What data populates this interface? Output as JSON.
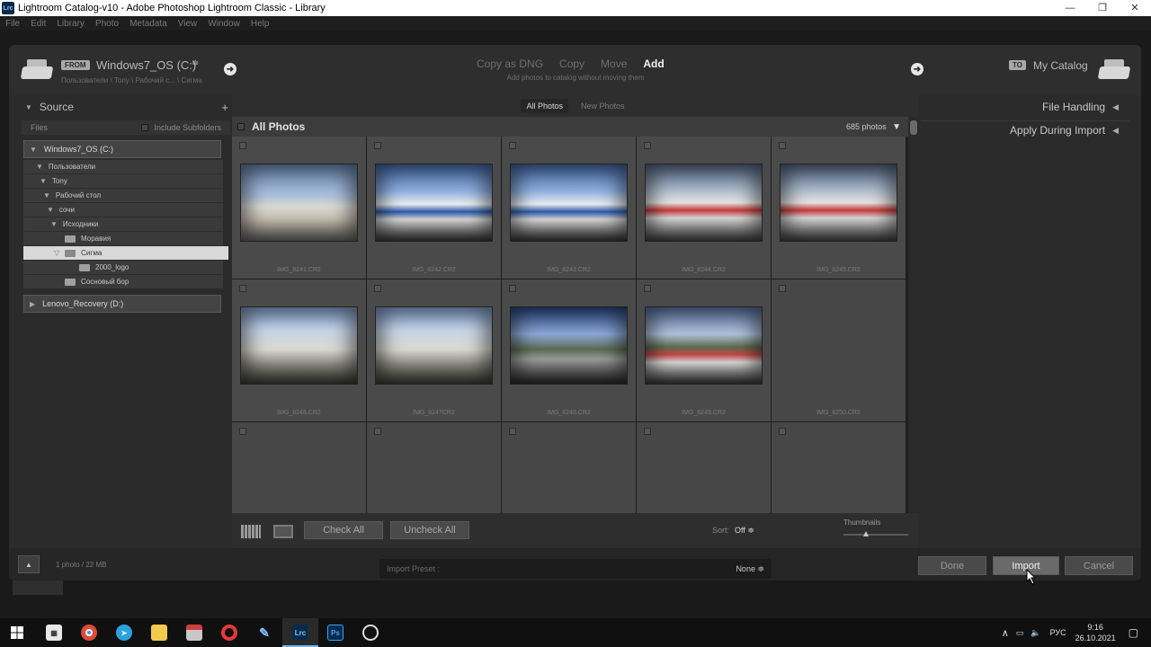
{
  "window": {
    "title": "Lightroom Catalog-v10 - Adobe Photoshop Lightroom Classic - Library",
    "app_icon": "Lrc",
    "controls": [
      "—",
      "❐",
      "✕"
    ]
  },
  "menu": [
    "File",
    "Edit",
    "Library",
    "Photo",
    "Metadata",
    "View",
    "Window",
    "Help"
  ],
  "header": {
    "from_tag": "FROM",
    "source_name": "Windows7_OS (C:)",
    "source_path": "Пользователи \\ Tony \\ Рабочий с... \\ Сигма",
    "modes": [
      "Copy as DNG",
      "Copy",
      "Move",
      "Add"
    ],
    "active_mode": "Add",
    "mode_description": "Add photos to catalog without moving them",
    "to_tag": "TO",
    "destination": "My Catalog"
  },
  "source_panel": {
    "title": "Source",
    "add_symbol": "+",
    "files_label": "Files",
    "include_subfolders": "Include Subfolders",
    "drive1": "Windows7_OS (C:)",
    "drive2": "Lenovo_Recovery (D:)",
    "folders": [
      {
        "label": "Пользователи",
        "type": "expanded"
      },
      {
        "label": "Tony",
        "type": "expanded"
      },
      {
        "label": "Рабочий стол",
        "type": "expanded"
      },
      {
        "label": "сочи",
        "type": "expanded"
      },
      {
        "label": "Исходники",
        "type": "expanded"
      },
      {
        "label": "Моравия",
        "type": "folder"
      },
      {
        "label": "Сигма",
        "type": "folder-selected"
      },
      {
        "label": "2000_logo",
        "type": "folder"
      },
      {
        "label": "Сосновый бор",
        "type": "folder"
      }
    ]
  },
  "view_tabs": {
    "all": "All Photos",
    "new": "New Photos"
  },
  "grid": {
    "title": "All Photos",
    "count": "685 photos",
    "cells": [
      {
        "filename": "IMG_8241.CR2",
        "scene": "blue-wall"
      },
      {
        "filename": "IMG_8242.CR2",
        "scene": "white-building"
      },
      {
        "filename": "IMG_8243.CR2",
        "scene": "white-building"
      },
      {
        "filename": "IMG_8244.CR2",
        "scene": "wide-red"
      },
      {
        "filename": "IMG_8245.CR2",
        "scene": "wide-red"
      },
      {
        "filename": "IMG_8246.CR2",
        "scene": "alley"
      },
      {
        "filename": "IMG_8247CR2",
        "scene": "alley"
      },
      {
        "filename": "IMG_8248.CR2",
        "scene": "hills"
      },
      {
        "filename": "IMG_8249.CR2",
        "scene": "hills-red"
      },
      {
        "filename": "IMG_8250.CR2",
        "scene": "empty"
      },
      {
        "filename": "",
        "scene": "empty"
      },
      {
        "filename": "",
        "scene": "empty"
      },
      {
        "filename": "",
        "scene": "empty"
      },
      {
        "filename": "",
        "scene": "empty"
      },
      {
        "filename": "",
        "scene": "empty"
      }
    ]
  },
  "toolbar": {
    "check_all": "Check All",
    "uncheck_all": "Uncheck All",
    "sort_label": "Sort:",
    "sort_value": "Off ≑",
    "thumbnails_label": "Thumbnails",
    "thumbnail_level": 0.35
  },
  "right_panel": {
    "file_handling": "File Handling",
    "apply_during_import": "Apply During Import"
  },
  "footer": {
    "photo_info": "1 photo / 22 MB",
    "preset_label": "Import Preset :",
    "preset_value": "None ≑",
    "done": "Done",
    "import": "Import",
    "cancel": "Cancel"
  },
  "taskbar": {
    "lang": "РУС",
    "time": "9:16",
    "date": "26.10.2021"
  }
}
